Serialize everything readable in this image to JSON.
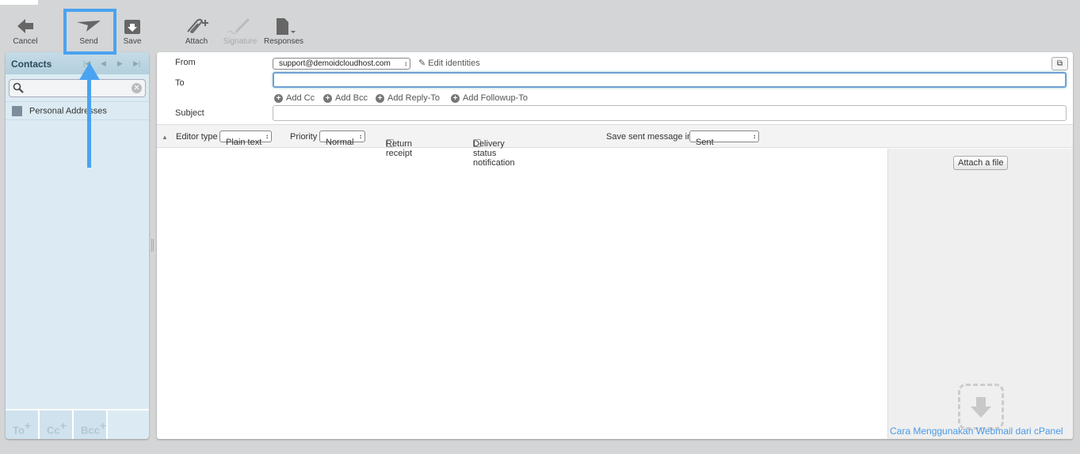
{
  "toolbar": {
    "cancel": "Cancel",
    "send": "Send",
    "save": "Save",
    "attach": "Attach",
    "signature": "Signature",
    "responses": "Responses"
  },
  "contacts": {
    "title": "Contacts",
    "search_placeholder": "",
    "groups": [
      {
        "label": "Personal Addresses"
      }
    ],
    "footer": [
      "To",
      "Cc",
      "Bcc"
    ]
  },
  "compose": {
    "from_label": "From",
    "from_value": "support@demoidcloudhost.com",
    "edit_identities": "Edit identities",
    "to_label": "To",
    "to_value": "",
    "add_links": [
      "Add Cc",
      "Add Bcc",
      "Add Reply-To",
      "Add Followup-To"
    ],
    "subject_label": "Subject",
    "subject_value": "",
    "editor_type_label": "Editor type",
    "editor_type": "Plain text",
    "priority_label": "Priority",
    "priority": "Normal",
    "return_receipt": "Return receipt",
    "return_receipt_checked": false,
    "dsn": "Delivery status notification",
    "dsn_checked": false,
    "save_in_label": "Save sent message in",
    "save_in": "Sent",
    "attach_file": "Attach a file",
    "link": "Cara Menggunakan Webmail dari cPanel"
  },
  "colors": {
    "highlight": "#4aa3f0",
    "link": "#4a9ae6"
  }
}
